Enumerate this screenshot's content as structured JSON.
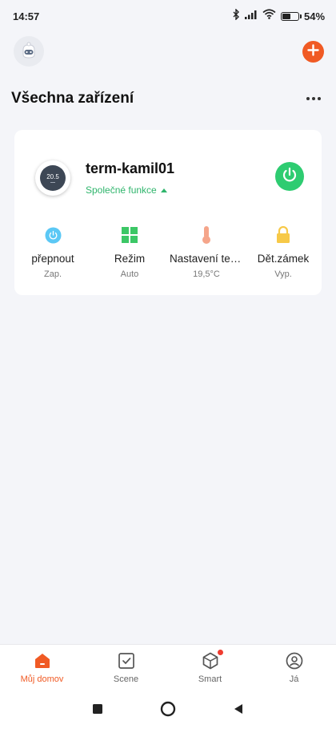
{
  "status_bar": {
    "time": "14:57",
    "battery_percent": "54",
    "battery_level": 0.54,
    "icons": [
      "bluetooth-icon",
      "signal-icon",
      "wifi-icon",
      "battery-icon"
    ]
  },
  "topbar": {
    "avatar_icon": "robot-avatar-icon",
    "add_icon": "plus-icon",
    "accent_color": "#f05a24"
  },
  "section": {
    "title": "Všechna zařízení",
    "more_icon": "more-dots-icon"
  },
  "device": {
    "name": "term-kamil01",
    "thermostat_display": "20.5",
    "subtitle": "Společné funkce",
    "power_state": "on",
    "power_color": "#2ecc71",
    "functions": [
      {
        "icon": "power-icon",
        "label": "přepnout",
        "value": "Zap."
      },
      {
        "icon": "grid-mode-icon",
        "label": "Režim",
        "value": "Auto"
      },
      {
        "icon": "thermometer-icon",
        "label": "Nastavení teploty",
        "value": "19,5°C"
      },
      {
        "icon": "lock-icon",
        "label": "Dět.zámek",
        "value": "Vyp."
      }
    ]
  },
  "tabbar": {
    "tabs": [
      {
        "icon": "home-icon",
        "label": "Můj domov",
        "active": true
      },
      {
        "icon": "scene-check-icon",
        "label": "Scene",
        "active": false
      },
      {
        "icon": "smart-cube-icon",
        "label": "Smart",
        "active": false,
        "badge": true
      },
      {
        "icon": "profile-icon",
        "label": "Já",
        "active": false
      }
    ]
  },
  "navbar": {
    "keys": [
      "recents-square-icon",
      "home-circle-icon",
      "back-triangle-icon"
    ]
  }
}
